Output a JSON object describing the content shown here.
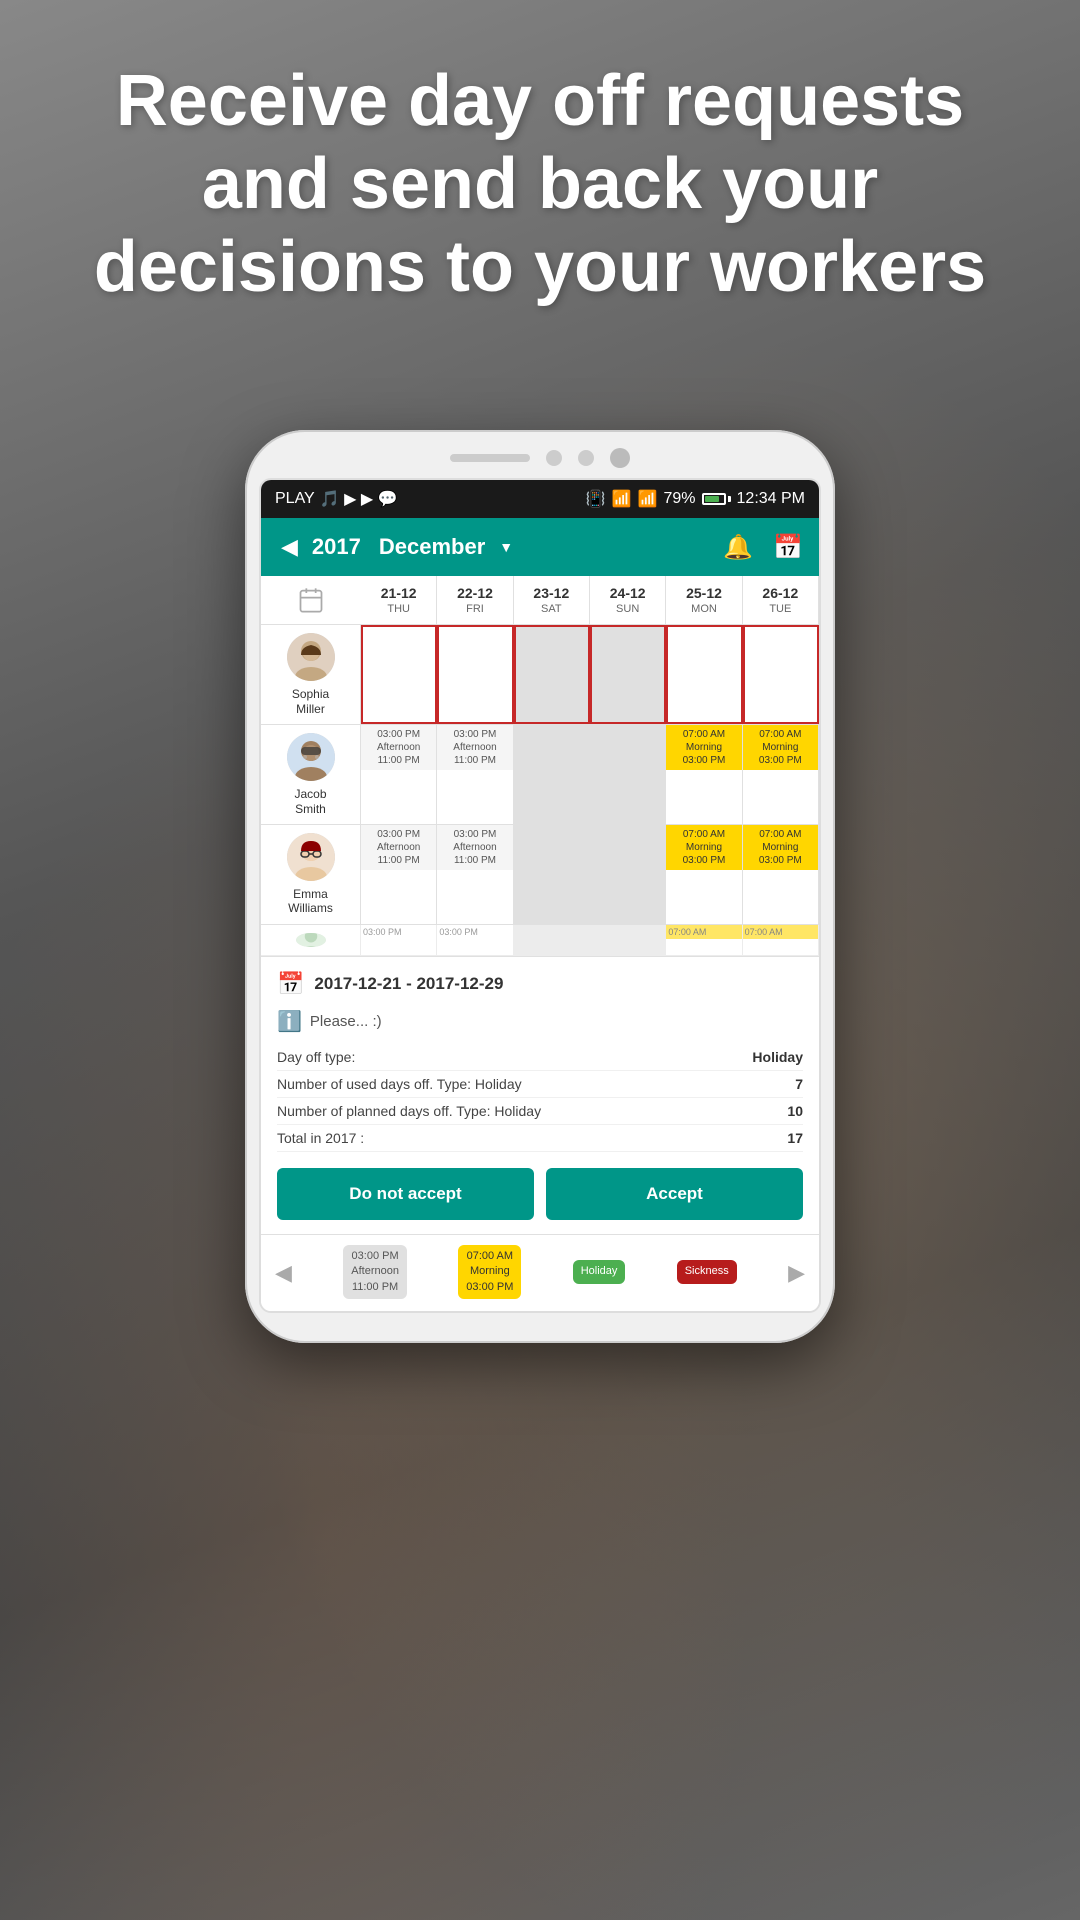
{
  "headline": {
    "line1": "Receive day off",
    "line2": "requests and send",
    "line3": "back your decisions to",
    "line4": "your workers",
    "full": "Receive day off requests and send back your decisions to your workers"
  },
  "status_bar": {
    "left": "PLAY",
    "battery_pct": "79%",
    "time": "12:34 PM",
    "signal": "◀◀"
  },
  "header": {
    "year": "2017",
    "month": "December",
    "back_label": "◀",
    "dropdown_icon": "▼"
  },
  "calendar": {
    "columns": [
      {
        "date": "21-12",
        "day": "THU"
      },
      {
        "date": "22-12",
        "day": "FRI"
      },
      {
        "date": "23-12",
        "day": "SAT"
      },
      {
        "date": "24-12",
        "day": "SUN"
      },
      {
        "date": "25-12",
        "day": "MON"
      },
      {
        "date": "26-12",
        "day": "TUE"
      }
    ],
    "employees": [
      {
        "name": "Sophia\nMiller",
        "name_line1": "Sophia",
        "name_line2": "Miller",
        "shifts": [
          {
            "type": "empty",
            "text": ""
          },
          {
            "type": "empty",
            "text": ""
          },
          {
            "type": "weekend",
            "text": ""
          },
          {
            "type": "weekend",
            "text": ""
          },
          {
            "type": "empty",
            "text": ""
          },
          {
            "type": "empty",
            "text": ""
          }
        ]
      },
      {
        "name": "Jacob\nSmith",
        "name_line1": "Jacob",
        "name_line2": "Smith",
        "shifts": [
          {
            "type": "gray",
            "lines": [
              "03:00 PM",
              "Afternoon",
              "11:00 PM"
            ]
          },
          {
            "type": "gray",
            "lines": [
              "03:00 PM",
              "Afternoon",
              "11:00 PM"
            ]
          },
          {
            "type": "weekend",
            "lines": []
          },
          {
            "type": "weekend",
            "lines": []
          },
          {
            "type": "yellow",
            "lines": [
              "07:00 AM",
              "Morning",
              "03:00 PM"
            ]
          },
          {
            "type": "yellow",
            "lines": [
              "07:00 AM",
              "Morning",
              "03:00 PM"
            ]
          }
        ]
      },
      {
        "name": "Emma\nWilliams",
        "name_line1": "Emma",
        "name_line2": "Williams",
        "shifts": [
          {
            "type": "gray",
            "lines": [
              "03:00 PM",
              "Afternoon",
              "11:00 PM"
            ]
          },
          {
            "type": "gray",
            "lines": [
              "03:00 PM",
              "Afternoon",
              "11:00 PM"
            ]
          },
          {
            "type": "weekend",
            "lines": []
          },
          {
            "type": "weekend",
            "lines": []
          },
          {
            "type": "yellow",
            "lines": [
              "07:00 AM",
              "Morning",
              "03:00 PM"
            ]
          },
          {
            "type": "yellow",
            "lines": [
              "07:00 AM",
              "Morning",
              "03:00 PM"
            ]
          }
        ]
      }
    ]
  },
  "info_panel": {
    "date_range": "2017-12-21 - 2017-12-29",
    "note": "Please... :)",
    "rows": [
      {
        "label": "Day off type:",
        "value": "Holiday"
      },
      {
        "label": "Number of used days off. Type: Holiday",
        "value": "7"
      },
      {
        "label": "Number of planned days off. Type: Holiday",
        "value": "10"
      },
      {
        "label": "Total in 2017 :",
        "value": "17"
      }
    ],
    "btn_reject": "Do not accept",
    "btn_accept": "Accept"
  },
  "legend": {
    "items": [
      {
        "label": "Afternoon",
        "lines": [
          "03:00 PM",
          "Afternoon",
          "11:00 PM"
        ],
        "style": "gray"
      },
      {
        "label": "Morning",
        "lines": [
          "07:00 AM",
          "Morning",
          "03:00 PM"
        ],
        "style": "yellow"
      },
      {
        "label": "Holiday",
        "lines": [
          "Holiday"
        ],
        "style": "green"
      },
      {
        "label": "Sickness",
        "lines": [
          "Sickness"
        ],
        "style": "red"
      }
    ],
    "prev": "◀",
    "next": "▶"
  },
  "colors": {
    "teal": "#009688",
    "yellow": "#ffd600",
    "green": "#4caf50",
    "dark_red": "#b71c1c",
    "gray_bg": "#e0e0e0"
  }
}
